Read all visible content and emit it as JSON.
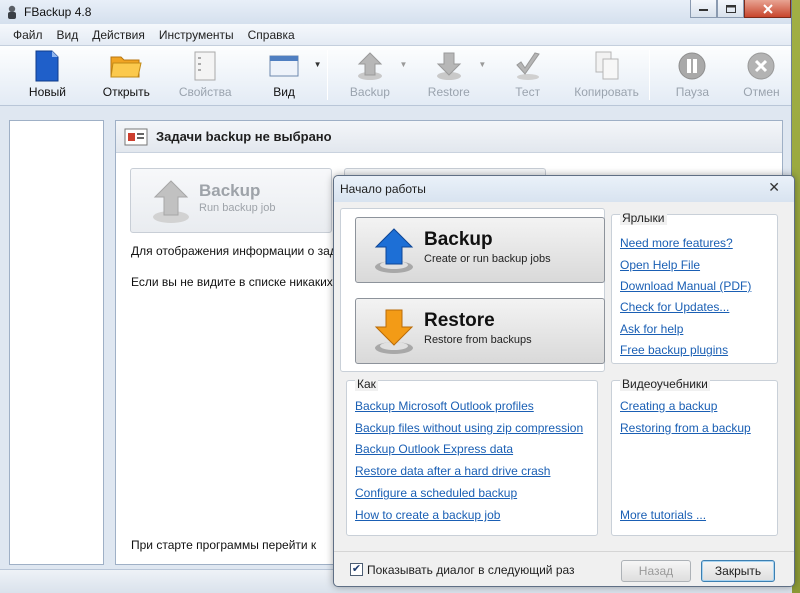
{
  "window": {
    "title": "FBackup  4.8",
    "colors": {
      "link": "#1a5fb4",
      "accent": "#d5e0ee"
    }
  },
  "menu": [
    "Файл",
    "Вид",
    "Действия",
    "Инструменты",
    "Справка"
  ],
  "toolbar": {
    "new": "Новый",
    "open": "Открыть",
    "properties": "Свойства",
    "view": "Вид",
    "backup": "Backup",
    "restore": "Restore",
    "test": "Тест",
    "copy": "Копировать",
    "pause": "Пауза",
    "cancel": "Отмен"
  },
  "content": {
    "header": "Задачи backup не выбрано",
    "run_title": "Backup",
    "run_sub": "Run backup job",
    "line1": "Для отображения информации о зад",
    "line2": "Если вы не видите в списке никаких з",
    "footer_text": "При старте программы перейти к"
  },
  "dialog": {
    "title": "Начало работы",
    "close_glyph": "✕",
    "backup_title": "Backup",
    "backup_sub": "Create or run backup jobs",
    "restore_title": "Restore",
    "restore_sub": "Restore from backups",
    "shortcuts": {
      "title": "Ярлыки",
      "links": [
        "Need more features?",
        "Open Help File",
        "Download Manual (PDF)",
        "Check for Updates...",
        "Ask for help",
        "Free backup plugins"
      ]
    },
    "howto": {
      "title": "Как",
      "links": [
        "Backup Microsoft Outlook profiles",
        "Backup files without using zip compression",
        "Backup Outlook Express data",
        "Restore data after a hard drive crash",
        "Configure a scheduled backup",
        "How to create a backup job"
      ]
    },
    "videos": {
      "title": "Видеоучебники",
      "links": [
        "Creating a backup",
        "Restoring from a backup"
      ],
      "more": "More tutorials ..."
    },
    "show_checkbox": "Показывать диалог в следующий раз",
    "checked_glyph": "✔",
    "back_button": "Назад",
    "close_button": "Закрыть"
  }
}
